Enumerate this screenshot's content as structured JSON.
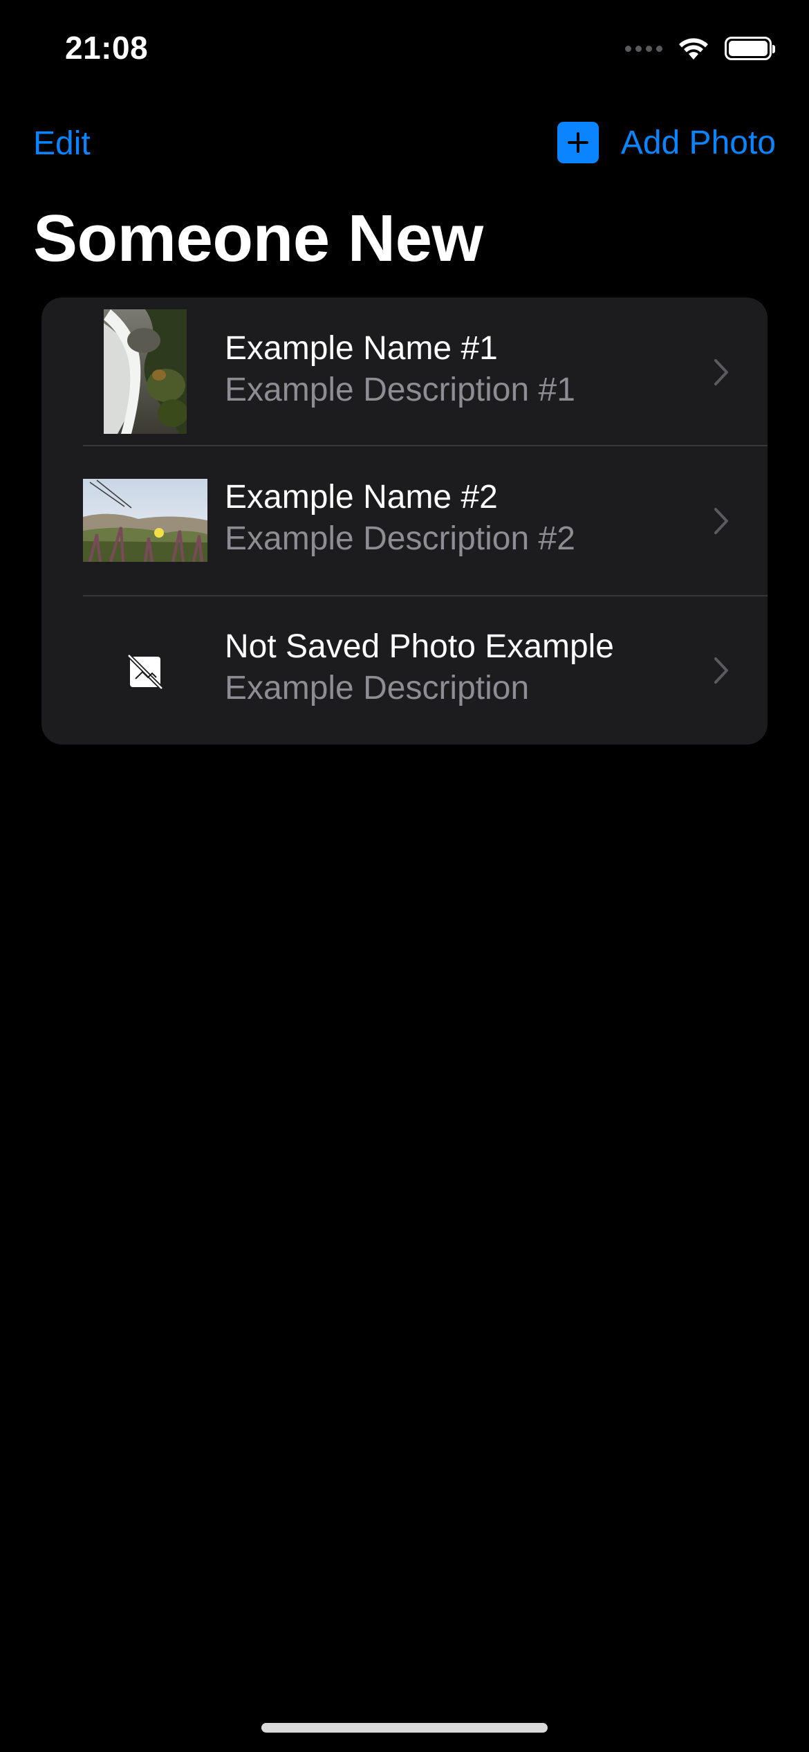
{
  "status_bar": {
    "time": "21:08",
    "icons": [
      "cellular-signal-icon",
      "wifi-icon",
      "battery-icon"
    ]
  },
  "nav": {
    "edit_label": "Edit",
    "add_label": "Add Photo",
    "add_icon": "plus-square-icon"
  },
  "title": "Someone New",
  "list": {
    "rows": [
      {
        "name": "Example Name #1",
        "description": "Example Description #1",
        "thumbnail": "waterfall-photo"
      },
      {
        "name": "Example Name #2",
        "description": "Example Description #2",
        "thumbnail": "hillside-flowers-photo"
      },
      {
        "name": "Not Saved Photo Example",
        "description": "Example Description",
        "thumbnail": "photo-unavailable-icon"
      }
    ]
  },
  "colors": {
    "background": "#000000",
    "accent": "#0a84ff",
    "card": "#1c1c1e",
    "secondary_text": "#8d8d93",
    "separator": "#38383a"
  }
}
